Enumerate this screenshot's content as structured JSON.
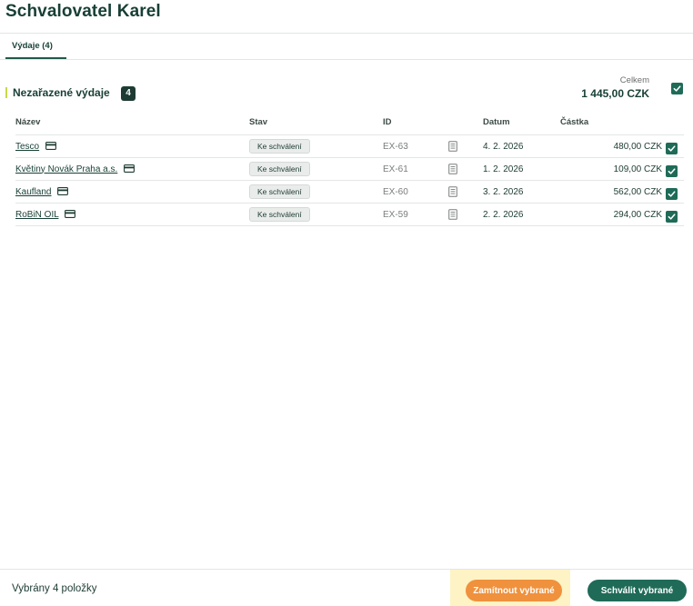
{
  "header": {
    "title": "Schvalovatel Karel"
  },
  "tabs": [
    {
      "label": "Výdaje (4)",
      "active": true
    }
  ],
  "section": {
    "title": "Nezařazené výdaje",
    "count": "4",
    "total_label": "Celkem",
    "total_value": "1 445,00 CZK",
    "all_selected": true
  },
  "table": {
    "columns": [
      "Název",
      "Stav",
      "ID",
      "Datum",
      "Částka"
    ],
    "rows": [
      {
        "name": "Tesco",
        "status": "Ke schválení",
        "id": "EX-63",
        "date": "4. 2. 2026",
        "amount": "480,00 CZK",
        "checked": true
      },
      {
        "name": "Květiny Novák Praha a.s.",
        "status": "Ke schválení",
        "id": "EX-61",
        "date": "1. 2. 2026",
        "amount": "109,00 CZK",
        "checked": true
      },
      {
        "name": "Kaufland",
        "status": "Ke schválení",
        "id": "EX-60",
        "date": "3. 2. 2026",
        "amount": "562,00 CZK",
        "checked": true
      },
      {
        "name": "RoBiN OIL",
        "status": "Ke schválení",
        "id": "EX-59",
        "date": "2. 2. 2026",
        "amount": "294,00 CZK",
        "checked": true
      }
    ]
  },
  "footer": {
    "selected_text": "Vybrány 4 položky",
    "reject_label": "Zamítnout vybrané",
    "approve_label": "Schválit vybrané"
  },
  "colors": {
    "primary": "#1f6b58",
    "dark": "#173f35",
    "reject": "#f0913d",
    "highlight": "#fdf3c4",
    "accent_bar": "#c8d94a"
  },
  "icons": {
    "card": "credit-card-icon",
    "receipt": "receipt-icon",
    "check": "checkmark-icon"
  }
}
